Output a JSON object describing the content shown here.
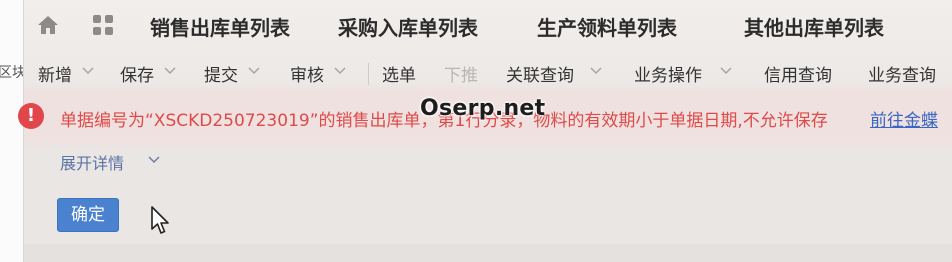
{
  "left_strip": {
    "cut_text": "区块"
  },
  "tabs": [
    {
      "label": "销售出库单列表"
    },
    {
      "label": "采购入库单列表"
    },
    {
      "label": "生产领料单列表"
    },
    {
      "label": "其他出库单列表"
    }
  ],
  "toolbar": {
    "new": "新增",
    "save": "保存",
    "submit": "提交",
    "audit": "审核",
    "select_order": "选单",
    "push_down": "下推",
    "related_query": "关联查询",
    "business_ops": "业务操作",
    "credit_query": "信用查询",
    "business_query": "业务查询"
  },
  "error": {
    "icon": "!",
    "message": "单据编号为“XSCKD250723019”的销售出库单，第1行分录，物料的有效期小于单据日期,不允许保存",
    "link": "前往金蝶"
  },
  "watermark": "Oserp.net",
  "details_toggle": "展开详情",
  "ok_button": "确定",
  "colors": {
    "error_red": "#df4a4a",
    "primary_blue": "#4a82cf",
    "link_blue": "#3a66c4"
  }
}
